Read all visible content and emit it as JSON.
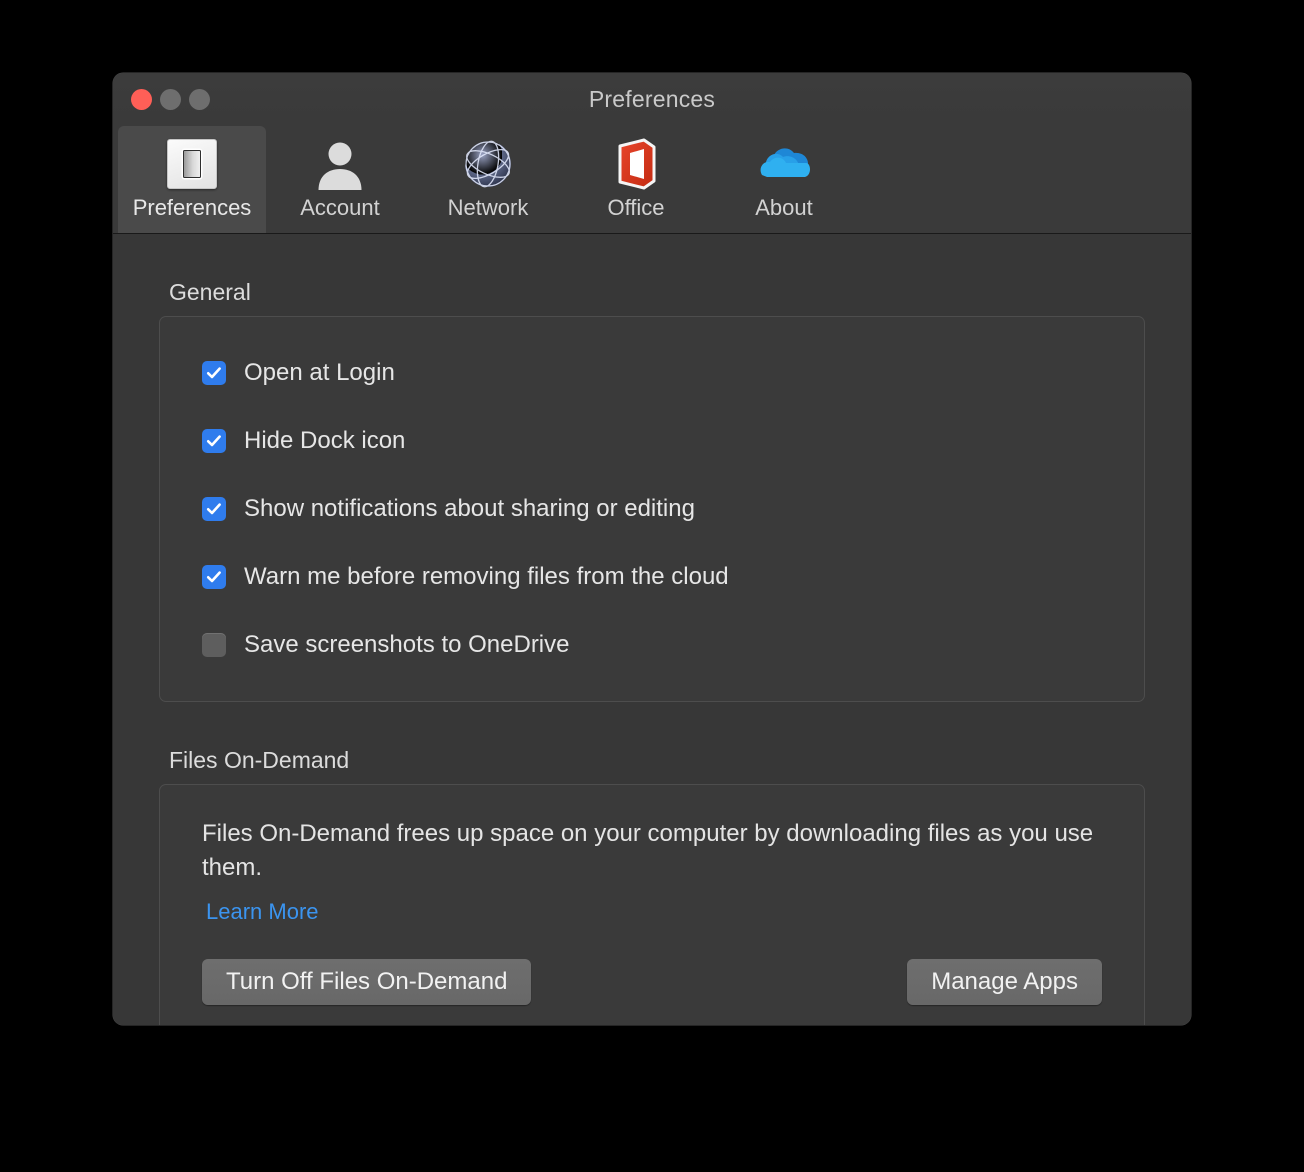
{
  "window": {
    "title": "Preferences",
    "traffic_lights": [
      "close-button",
      "minimize-button",
      "zoom-button"
    ]
  },
  "toolbar": {
    "tabs": [
      {
        "label": "Preferences",
        "icon": "light-switch-icon",
        "selected": true
      },
      {
        "label": "Account",
        "icon": "person-icon",
        "selected": false
      },
      {
        "label": "Network",
        "icon": "globe-icon",
        "selected": false
      },
      {
        "label": "Office",
        "icon": "office-door-icon",
        "selected": false
      },
      {
        "label": "About",
        "icon": "onedrive-cloud-icon",
        "selected": false
      }
    ]
  },
  "general": {
    "title": "General",
    "options": [
      {
        "label": "Open at Login",
        "checked": true
      },
      {
        "label": "Hide Dock icon",
        "checked": true
      },
      {
        "label": "Show notifications about sharing or editing",
        "checked": true
      },
      {
        "label": "Warn me before removing files from the cloud",
        "checked": true
      },
      {
        "label": "Save screenshots to OneDrive",
        "checked": false
      }
    ]
  },
  "files_on_demand": {
    "title": "Files On-Demand",
    "description": "Files On-Demand frees up space on your computer by downloading files as you use them.",
    "learn_more": "Learn More",
    "turn_off_button": "Turn Off Files On-Demand",
    "manage_apps_button": "Manage Apps"
  },
  "colors": {
    "accent_blue": "#2f7ced",
    "link_blue": "#3b94ef",
    "window_bg": "#373737",
    "toolbar_bg": "#3a3a3a",
    "close_red": "#ff5f57"
  }
}
